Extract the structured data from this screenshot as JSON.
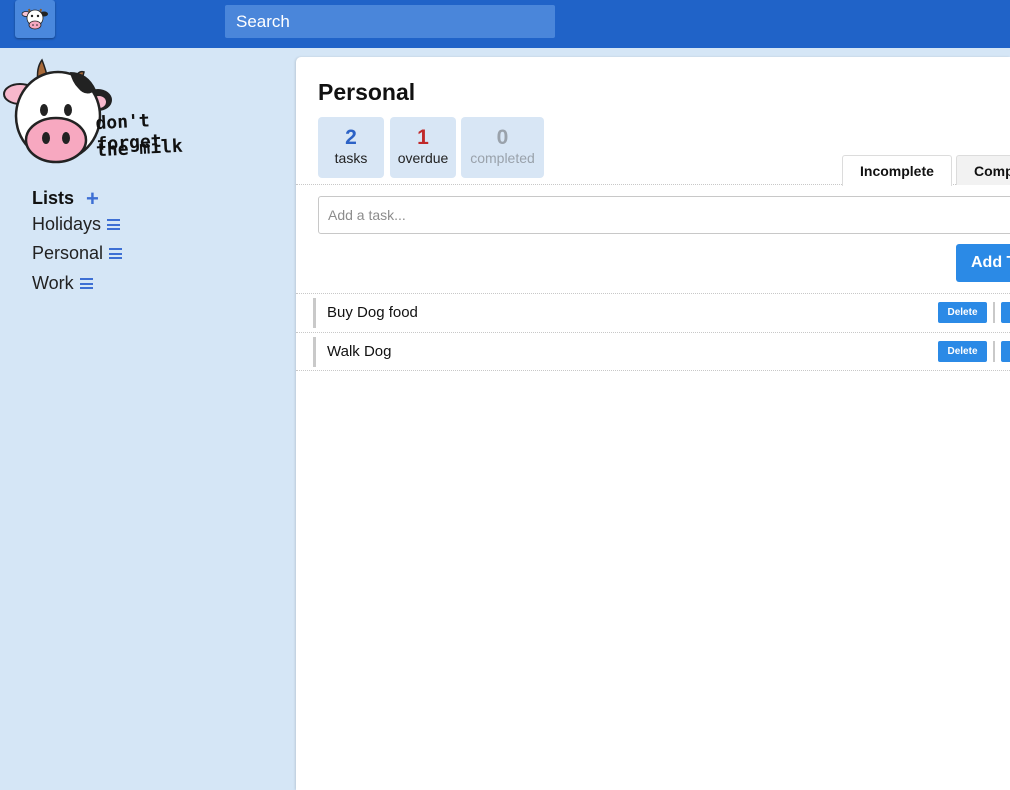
{
  "search": {
    "placeholder": "Search"
  },
  "logo": {
    "line1": "don't forget",
    "line2": "the milk"
  },
  "sidebar": {
    "lists_label": "Lists",
    "items": [
      {
        "label": "Holidays"
      },
      {
        "label": "Personal"
      },
      {
        "label": "Work"
      }
    ]
  },
  "main": {
    "title": "Personal",
    "stats": [
      {
        "value": "2",
        "label": "tasks",
        "color": "#2c62c6"
      },
      {
        "value": "1",
        "label": "overdue",
        "color": "#c0292a"
      },
      {
        "value": "0",
        "label": "completed",
        "color": "#9aa2ab"
      }
    ],
    "tabs": [
      {
        "label": "Incomplete"
      },
      {
        "label": "Comp"
      }
    ],
    "add_task": {
      "placeholder": "Add a task...",
      "button": "Add T"
    },
    "tasks": [
      {
        "name": "Buy Dog food",
        "delete_label": "Delete"
      },
      {
        "name": "Walk Dog",
        "delete_label": "Delete"
      }
    ]
  },
  "colors": {
    "topbar": "#2063c8",
    "sidebar_bg": "#d5e6f6",
    "accent": "#2b8ae6"
  }
}
